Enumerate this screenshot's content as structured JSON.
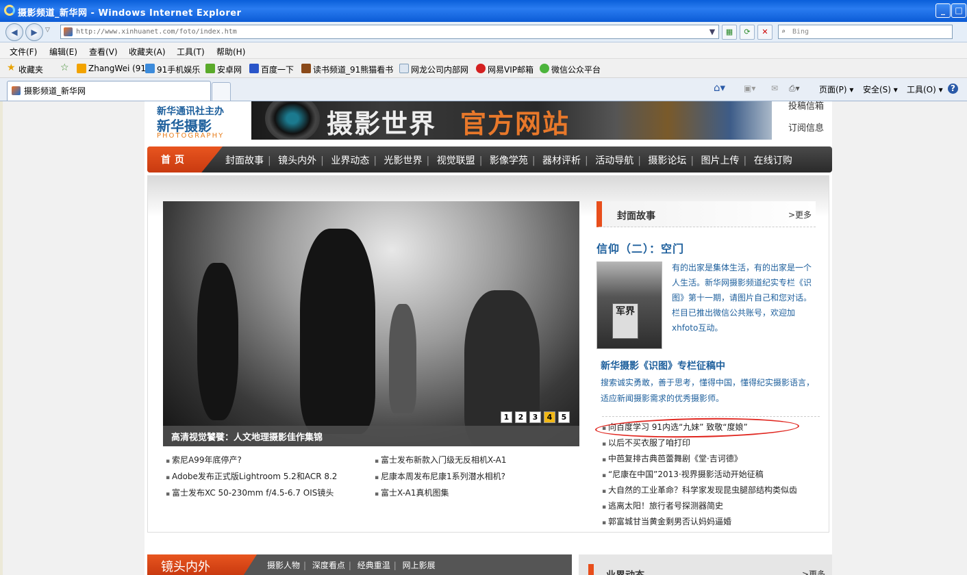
{
  "window": {
    "title": "摄影频道_新华网 - Windows Internet Explorer"
  },
  "address": {
    "url": "http://www.xinhuanet.com/foto/index.htm",
    "search_placeholder": "Bing"
  },
  "menu": [
    "文件(F)",
    "编辑(E)",
    "查看(V)",
    "收藏夹(A)",
    "工具(T)",
    "帮助(H)"
  ],
  "favorites": {
    "label": "收藏夹",
    "items": [
      "ZhangWei (91)",
      "91手机娱乐",
      "安卓网",
      "百度一下",
      "读书频道_91熊猫看书",
      "网龙公司内部网",
      "网易VIP邮箱",
      "微信公众平台"
    ]
  },
  "tabs": {
    "active": "摄影频道_新华网"
  },
  "commandbar": {
    "page": "页面(P)",
    "safety": "安全(S)",
    "tools": "工具(O)",
    "help": "?"
  },
  "site": {
    "logo": {
      "line1": "新华通讯社主办",
      "line2": "新华摄影",
      "line3": "PHOTOGRAPHY"
    },
    "banner": {
      "text": "摄影世界",
      "text2": "官方网站"
    },
    "header_links": [
      "投稿信箱",
      "订阅信息"
    ],
    "nav": {
      "home": "首页",
      "items": [
        "封面故事",
        "镜头内外",
        "业界动态",
        "光影世界",
        "视觉联盟",
        "影像学苑",
        "器材评析",
        "活动导航",
        "摄影论坛",
        "图片上传",
        "在线订购"
      ]
    },
    "slider": {
      "caption": "高清视觉饕餮：人文地理摄影佳作集锦",
      "pages": [
        "1",
        "2",
        "3",
        "4",
        "5"
      ],
      "active_page": "4"
    },
    "news_left": [
      "索尼A99年底停产?",
      "Adobe发布正式版Lightroom 5.2和ACR 8.2",
      "富士发布XC 50-230mm f/4.5-6.7 OIS镜头"
    ],
    "news_right": [
      "富士发布新款入门级无反相机X-A1",
      "尼康本周发布尼康1系列潜水相机?",
      "富士X-A1真机图集"
    ],
    "cover": {
      "section": "封面故事",
      "more": ">更多",
      "title": "信仰（二）：空门",
      "thumb_text": "军界",
      "text": "有的出家是集体生活，有的出家是一个人生活。新华网摄影频道纪实专栏《识图》第十一期，请图片自己和您对话。栏目已推出微信公共账号，欢迎加xhfoto互动。",
      "call_title": "新华摄影《识图》专栏征稿中",
      "call_text": "搜索诚实勇敢，善于思考，懂得中国，懂得纪实摄影语言，适应新闻摄影需求的优秀摄影师。",
      "list": [
        "向百度学习 91内选“九妹” 致敬“度娘”",
        "以后不买衣服了咱打印",
        "中芭复排古典芭蕾舞剧《堂·吉诃德》",
        "“尼康在中国”2013·视界摄影活动开始征稿",
        "大自然的工业革命？科学家发现昆虫腿部结构类似齿",
        "逃离太阳！旅行者号探测器简史",
        "郭富城甘当黄金剩男否认妈妈逼婚"
      ]
    },
    "section2": {
      "title": "镜头内外",
      "items": [
        "摄影人物",
        "深度看点",
        "经典重温",
        "网上影展"
      ]
    },
    "section3": {
      "title": "业界动态",
      "more": ">更多"
    }
  }
}
